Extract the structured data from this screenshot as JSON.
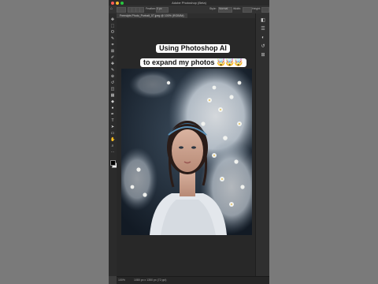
{
  "window": {
    "title": "Adobe Photoshop (Beta)"
  },
  "options_bar": {
    "home_icon": "home-icon",
    "feather_label": "Feather:",
    "feather_value": "0 px",
    "style_label": "Style:",
    "style_value": "Normal",
    "width_label": "Width:",
    "height_label": "Height:"
  },
  "document_tab": {
    "label": "Freestyle-Photo_Portrait_07.jpeg @ 100% (RGB/8#)"
  },
  "caption": {
    "line1": "Using Photoshop AI",
    "line2": "to expand my photos 🤯🤯🤯"
  },
  "status_bar": {
    "zoom": "100%",
    "doc_info": "1080 px x 1350 px (72 ppi)"
  },
  "toolbar": {
    "tools": [
      "move-icon",
      "marquee-icon",
      "lasso-icon",
      "quick-select-icon",
      "crop-icon",
      "frame-icon",
      "eyedropper-icon",
      "healing-brush-icon",
      "brush-icon",
      "clone-stamp-icon",
      "history-brush-icon",
      "eraser-icon",
      "gradient-icon",
      "blur-icon",
      "dodge-icon",
      "pen-icon",
      "type-icon",
      "path-select-icon",
      "rectangle-icon",
      "hand-icon",
      "zoom-icon",
      "more-icon"
    ],
    "glyphs": [
      "✥",
      "⬚",
      "ʘ",
      "✎",
      "⌗",
      "⊠",
      "✐",
      "✚",
      "✎",
      "⊕",
      "↺",
      "◫",
      "▦",
      "◆",
      "●",
      "✒",
      "T",
      "➤",
      "▭",
      "✋",
      "⌕",
      "⋯"
    ]
  },
  "colors": {
    "foreground": "#000000",
    "background": "#ffffff",
    "accent_close": "#ff5f57",
    "accent_min": "#febc2e",
    "accent_max": "#28c840"
  },
  "right_panel": {
    "icons": [
      "layers-icon",
      "properties-icon",
      "adjustments-icon",
      "history-icon",
      "libraries-icon"
    ],
    "glyphs": [
      "◧",
      "☰",
      "◐",
      "↺",
      "⊞"
    ]
  }
}
